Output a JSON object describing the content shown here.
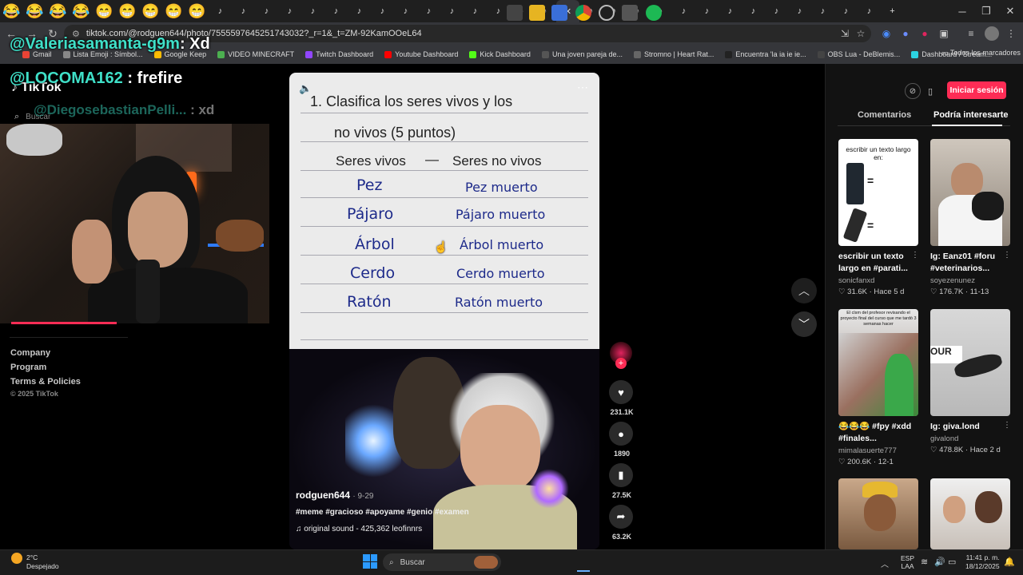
{
  "browser": {
    "url": "tiktok.com/@rodguen644/photo/7555597645251743032?_r=1&_t=ZM-92KamOOeL64",
    "tabs": [
      "😂",
      "😂",
      "😂",
      "😂",
      "😁",
      "😁",
      "😁",
      "😁",
      "😁"
    ],
    "tiktok_tab_count": 29
  },
  "bookmarks": [
    {
      "label": "Gmail",
      "color": "#ea4335"
    },
    {
      "label": "Lista Emoji : Símbol...",
      "color": "#888"
    },
    {
      "label": "Google Keep",
      "color": "#fbbc04"
    },
    {
      "label": "VIDEO MINECRAFT",
      "color": "#4caf50"
    },
    {
      "label": "Twitch Dashboard",
      "color": "#9146ff"
    },
    {
      "label": "Youtube Dashboard",
      "color": "#ff0000"
    },
    {
      "label": "Kick Dashboard",
      "color": "#53fc18"
    },
    {
      "label": "Una joven pareja de...",
      "color": "#555"
    },
    {
      "label": "Stromno | Heart Rat...",
      "color": "#666"
    },
    {
      "label": "Encuentra 'la ia ie ie...",
      "color": "#222"
    },
    {
      "label": "OBS Lua - DeBlemis...",
      "color": "#444"
    },
    {
      "label": "Dashboard / Stream...",
      "color": "#2cd3e1"
    }
  ],
  "all_bookmarks": "Todos los marcadores",
  "stream_overlay": {
    "chat1_user": "@Valeriasamanta-g9m",
    "chat1_msg": ": Xd",
    "chat2_user": "@LOCOMA162",
    "chat2_msg": ": frefire",
    "chat3_user": "@DiegosebastianPelli...",
    "chat3_msg": ": xd"
  },
  "tiktok": {
    "logo": "TikTok",
    "search_placeholder": "Buscar",
    "login_button": "Iniciar sesión",
    "sidebar_links": [
      "Company",
      "Program",
      "Terms & Policies"
    ],
    "copyright": "© 2025 TikTok"
  },
  "post": {
    "question_title": "1. Clasifica los seres vivos y los",
    "question_sub": "no vivos (5 puntos)",
    "col_living": "Seres vivos",
    "dash": "—",
    "col_nonliving": "Seres no vivos",
    "rows": [
      {
        "living": "Pez",
        "nonliving": "Pez muerto"
      },
      {
        "living": "Pájaro",
        "nonliving": "Pájaro muerto"
      },
      {
        "living": "Árbol",
        "nonliving": "Árbol muerto"
      },
      {
        "living": "Cerdo",
        "nonliving": "Cerdo muerto"
      },
      {
        "living": "Ratón",
        "nonliving": "Ratón muerto"
      }
    ],
    "author": "rodguen644",
    "date": "· 9-29",
    "hashtags": "#meme #gracioso #apoyame #genio #examen",
    "sound": "original sound - 425,362 leofinnrs",
    "likes": "231.1K",
    "comments": "1890",
    "saves": "27.5K",
    "shares": "63.2K"
  },
  "panel": {
    "tab_comments": "Comentarios",
    "tab_suggested": "Podría interesarte",
    "cards": [
      {
        "thumb_text": "escribir un texto largo en:",
        "title": "escribir un texto largo en #parati...",
        "user": "sonicfanxd",
        "likes": "31.6K",
        "when": "· Hace 5 d"
      },
      {
        "thumb_text": "",
        "title": "Ig: Eanz01 #foru #veterinarios...",
        "user": "soyezenunez",
        "likes": "176.7K",
        "when": "· 11-13"
      },
      {
        "thumb_text": "El clsm del profesor revisando el proyecto final del curso que me tardó 3 semanas hacer",
        "title": "😂😂😂 #fpy #xdd #finales...",
        "user": "mimalasuerte777",
        "likes": "200.6K",
        "when": "· 12-1"
      },
      {
        "thumb_text": "",
        "title": "Ig: giva.lond",
        "user": "givalond",
        "likes": "478.8K",
        "when": "· Hace 2 d"
      }
    ]
  },
  "taskbar": {
    "weather_temp": "2°C",
    "weather_desc": "Despejado",
    "search": "Buscar",
    "lang1": "ESP",
    "lang2": "LAA",
    "time": "11:41 p. m.",
    "date": "18/12/2025"
  }
}
